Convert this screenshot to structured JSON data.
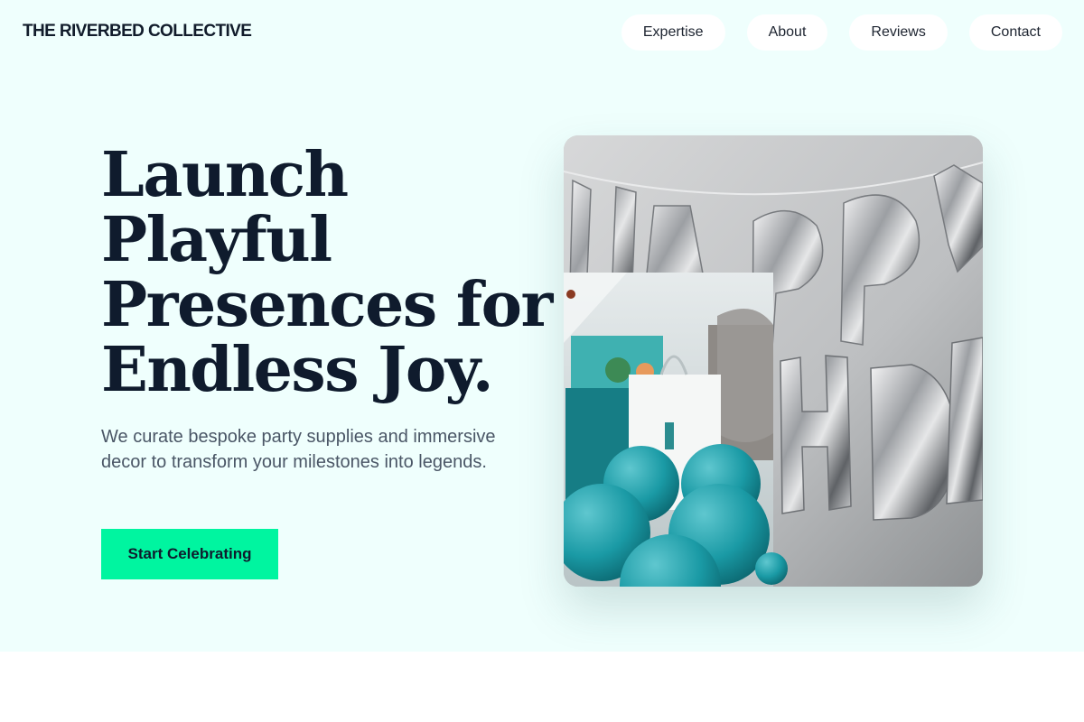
{
  "header": {
    "brand": "THE RIVERBED COLLECTIVE",
    "nav": [
      {
        "label": "Expertise"
      },
      {
        "label": "About"
      },
      {
        "label": "Reviews"
      },
      {
        "label": "Contact"
      }
    ]
  },
  "hero": {
    "headline_lines": [
      "Launch",
      "Playful",
      "Presences for",
      "Endless Joy."
    ],
    "lead": "We curate bespoke party supplies and immersive decor to transform your milestones into legends.",
    "cta_label": "Start Celebrating",
    "images": {
      "main": "silver-foil-happy-birthday-balloons-photo",
      "inset": "gift-bags-and-teal-balloons-photo"
    }
  },
  "colors": {
    "hero_background": "#effffd",
    "cta_background": "#00f5a0",
    "headline": "#0f1b2d",
    "body_text": "#4a5666"
  }
}
